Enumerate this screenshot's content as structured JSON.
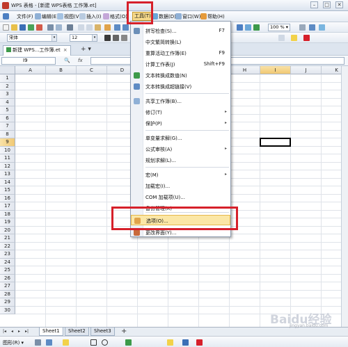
{
  "window": {
    "title": "WPS 表格 - [新建 WPS表格 工作簿.et]",
    "min": "–",
    "max": "□",
    "close": "✕"
  },
  "menubar": {
    "items": [
      "文件(F)",
      "编辑(E)",
      "视图(V)",
      "插入(I)",
      "格式(O)",
      "工具(T)",
      "数据(D)",
      "窗口(W)",
      "帮助(H)"
    ]
  },
  "toolbar": {
    "font_name": "宋体",
    "font_size": "12",
    "zoom": "100 %"
  },
  "doc_tab": {
    "label": "新建 WPS...工作簿.et",
    "close": "×",
    "new": "+ ▾"
  },
  "formula_bar": {
    "cell_ref": "I9",
    "fx": "fx"
  },
  "columns": [
    "A",
    "B",
    "C",
    "D",
    "E",
    "F",
    "G",
    "H",
    "I",
    "J",
    "K"
  ],
  "rows": [
    "1",
    "2",
    "3",
    "4",
    "5",
    "6",
    "7",
    "8",
    "9",
    "10",
    "11",
    "12",
    "13",
    "14",
    "15",
    "16",
    "17",
    "18",
    "19",
    "20",
    "21",
    "22",
    "23",
    "24",
    "25",
    "26",
    "27",
    "28",
    "29",
    "30"
  ],
  "selected_cell": {
    "column": "I",
    "row": "9"
  },
  "tools_menu": {
    "items": [
      {
        "label": "拼写检查(S)...",
        "shortcut": "F7"
      },
      {
        "label": "中文繁简转换(L)",
        "shortcut": ""
      },
      {
        "label": "重算活动工作簿(E)",
        "shortcut": "F9"
      },
      {
        "label": "计算工作表(J)",
        "shortcut": "Shift+F9"
      },
      {
        "label": "文本转换成数值(N)",
        "shortcut": ""
      },
      {
        "label": "文本转换成超链接(V)",
        "shortcut": ""
      },
      {
        "label": "共享工作簿(B)...",
        "shortcut": ""
      },
      {
        "label": "修订(T)",
        "shortcut": ""
      },
      {
        "label": "保护(P)",
        "shortcut": ""
      },
      {
        "label": "单变量求解(G)...",
        "shortcut": ""
      },
      {
        "label": "公式审核(A)",
        "shortcut": ""
      },
      {
        "label": "规划求解(L)...",
        "shortcut": ""
      },
      {
        "label": "宏(M)",
        "shortcut": ""
      },
      {
        "label": "加载宏(I)...",
        "shortcut": ""
      },
      {
        "label": "COM 加载项(U)...",
        "shortcut": ""
      },
      {
        "label": "备份管理(K)",
        "shortcut": ""
      },
      {
        "label": "选项(O)...",
        "shortcut": ""
      },
      {
        "label": "更改界面(Y)...",
        "shortcut": ""
      }
    ],
    "submenu_arrow": "▸"
  },
  "sheet_tabs": [
    "Sheet1",
    "Sheet2",
    "Sheet3"
  ],
  "sheet_nav": [
    "|◂",
    "◂",
    "▸",
    "▸|"
  ],
  "add_sheet": "+",
  "draw_toolbar": {
    "label": "图形(R) ▾"
  },
  "watermark": {
    "text": "Baidu经验",
    "sub": "jingyan.baidu.com"
  },
  "colors": {
    "highlight_red": "#d6202a",
    "menu_highlight": "#fbe7a6"
  }
}
